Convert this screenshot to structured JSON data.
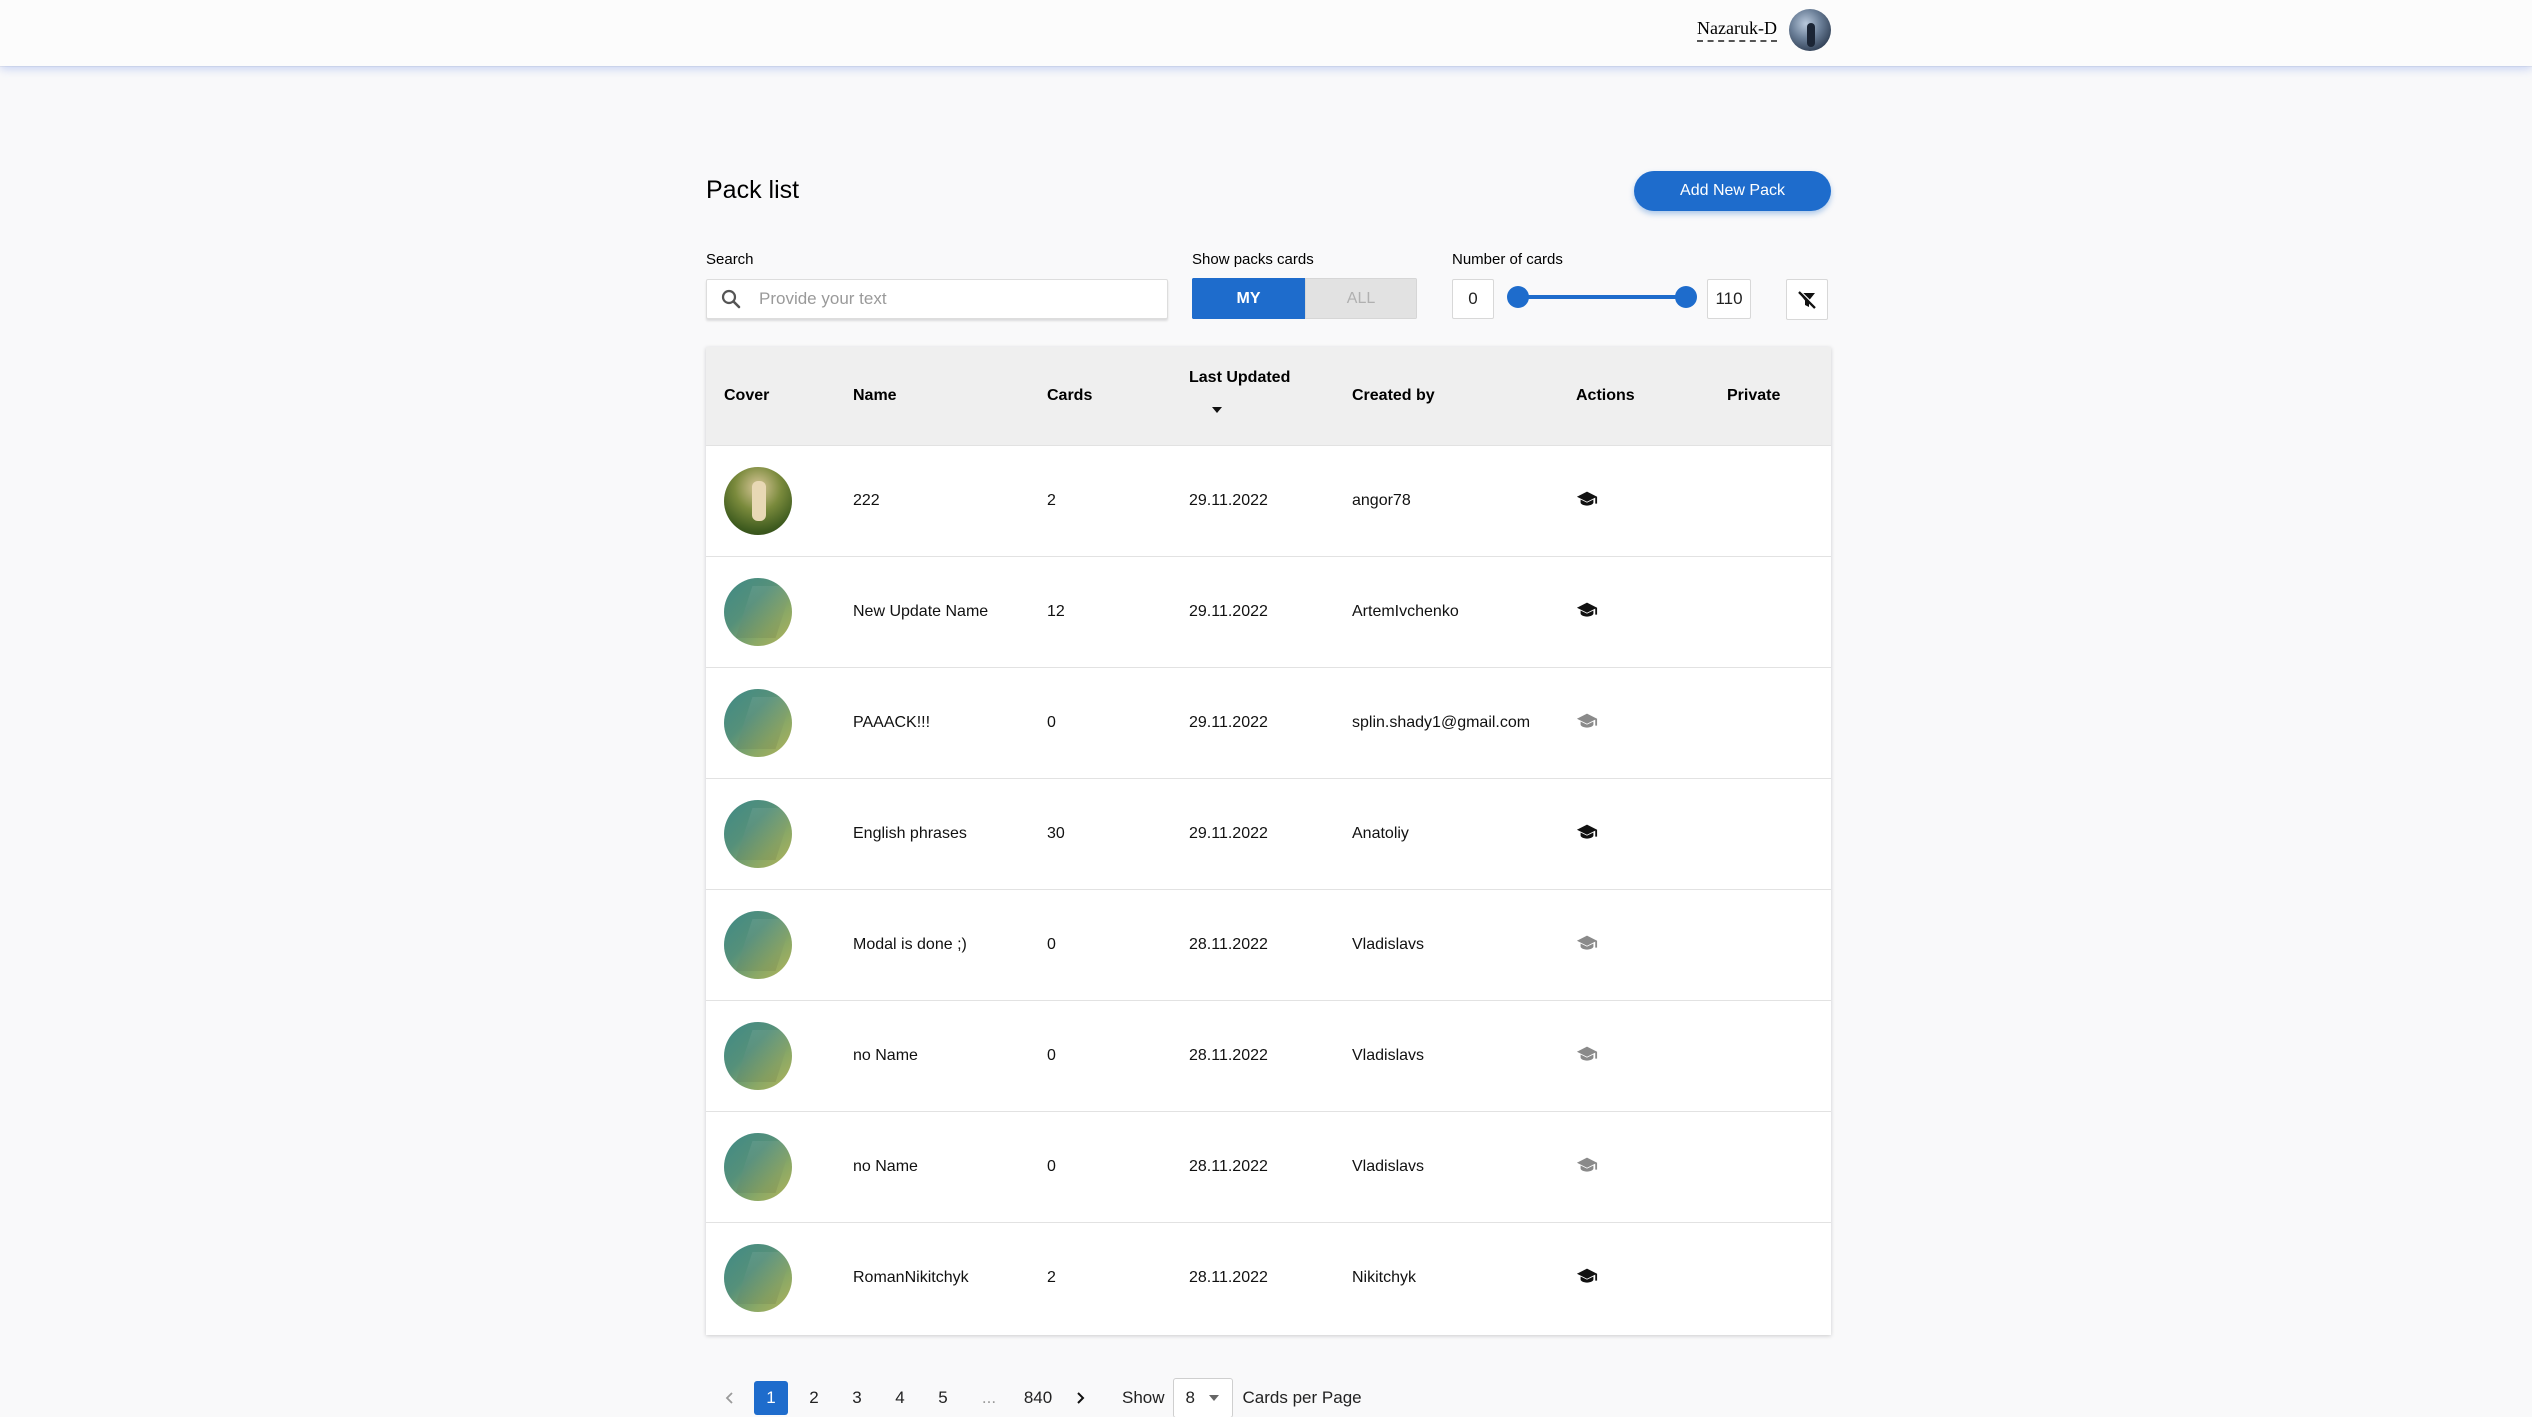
{
  "header": {
    "user_name": "Nazaruk-D"
  },
  "page": {
    "title": "Pack list",
    "add_button": "Add New Pack"
  },
  "filters": {
    "search_label": "Search",
    "search_placeholder": "Provide your text",
    "search_value": "",
    "show_label": "Show packs cards",
    "show_options": [
      "MY",
      "ALL"
    ],
    "show_selected": "MY",
    "cards_label": "Number of cards",
    "min": "0",
    "max": "110",
    "range_min": 0,
    "range_max": 110,
    "accent_color": "#1e6ccc"
  },
  "table": {
    "headers": [
      "Cover",
      "Name",
      "Cards",
      "Last Updated",
      "Created by",
      "Actions",
      "Private"
    ],
    "sort_column": "Last Updated",
    "rows": [
      {
        "name": "222",
        "cards": "2",
        "updated": "29.11.2022",
        "created_by": "angor78",
        "cover": "photo",
        "learn_enabled": true
      },
      {
        "name": "New Update Name",
        "cards": "12",
        "updated": "29.11.2022",
        "created_by": "ArtemIvchenko",
        "cover": "default",
        "learn_enabled": true
      },
      {
        "name": "PAAACK!!!",
        "cards": "0",
        "updated": "29.11.2022",
        "created_by": "splin.shady1@gmail.com",
        "cover": "default",
        "learn_enabled": false
      },
      {
        "name": "English phrases",
        "cards": "30",
        "updated": "29.11.2022",
        "created_by": "Anatoliy",
        "cover": "default",
        "learn_enabled": true
      },
      {
        "name": "Modal is done ;)",
        "cards": "0",
        "updated": "28.11.2022",
        "created_by": "Vladislavs",
        "cover": "default",
        "learn_enabled": false
      },
      {
        "name": "no Name",
        "cards": "0",
        "updated": "28.11.2022",
        "created_by": "Vladislavs",
        "cover": "default",
        "learn_enabled": false
      },
      {
        "name": "no Name",
        "cards": "0",
        "updated": "28.11.2022",
        "created_by": "Vladislavs",
        "cover": "default",
        "learn_enabled": false
      },
      {
        "name": "RomanNikitchyk",
        "cards": "2",
        "updated": "28.11.2022",
        "created_by": "Nikitchyk",
        "cover": "default",
        "learn_enabled": true
      }
    ]
  },
  "pagination": {
    "pages": [
      "1",
      "2",
      "3",
      "4",
      "5",
      "...",
      "840"
    ],
    "current": "1",
    "show_label": "Show",
    "per_page": "8",
    "per_page_suffix": "Cards per Page"
  }
}
